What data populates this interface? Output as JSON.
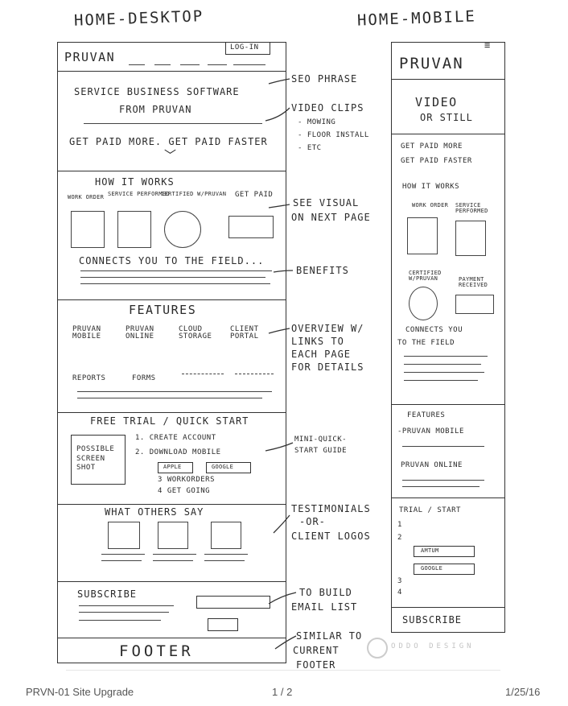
{
  "titles": {
    "desktop": "HOME-DESKTOP",
    "mobile": "HOME-MOBILE"
  },
  "desktop": {
    "logo": "PRUVAN",
    "login": "LOG-IN",
    "hero": {
      "line1": "SERVICE BUSINESS SOFTWARE",
      "line2": "FROM PRUVAN",
      "tagline": "GET PAID MORE. GET PAID FASTER"
    },
    "how": {
      "title": "HOW IT WORKS",
      "steps": [
        "WORK ORDER",
        "SERVICE PERFORMED",
        "CERTIFIED W/PRUVAN",
        "GET PAID"
      ],
      "connects": "CONNECTS YOU TO THE FIELD..."
    },
    "features": {
      "title": "FEATURES",
      "row1": [
        "PRUVAN MOBILE",
        "PRUVAN ONLINE",
        "CLOUD STORAGE",
        "CLIENT PORTAL"
      ],
      "row2": [
        "REPORTS",
        "FORMS"
      ]
    },
    "trial": {
      "title": "FREE TRIAL / QUICK START",
      "screenshot": "POSSIBLE SCREEN SHOT",
      "steps": [
        "1. CREATE ACCOUNT",
        "2. DOWNLOAD MOBILE",
        "3 WORKORDERS",
        "4 GET GOING"
      ],
      "apple": "APPLE",
      "google": "GOOGLE"
    },
    "testimonials": {
      "title": "WHAT OTHERS SAY"
    },
    "subscribe": {
      "title": "SUBSCRIBE"
    },
    "footer": "FOOTER"
  },
  "annotations": {
    "seo": "SEO PHRASE",
    "video": [
      "VIDEO CLIPS",
      "- MOWING",
      "- FLOOR INSTALL",
      "- ETC"
    ],
    "visual": [
      "SEE VISUAL",
      "ON NEXT PAGE"
    ],
    "benefits": "BENEFITS",
    "overview": [
      "OVERVIEW W/",
      "LINKS TO",
      "EACH PAGE",
      "FOR DETAILS"
    ],
    "mini": [
      "MINI-QUICK-",
      "START GUIDE"
    ],
    "testimonials": [
      "TESTIMONIALS",
      "-OR-",
      "CLIENT LOGOS"
    ],
    "email": [
      "TO BUILD",
      "EMAIL LIST"
    ],
    "similar": [
      "SIMILAR TO",
      "CURRENT",
      "FOOTER"
    ]
  },
  "mobile": {
    "logo": "PRUVAN",
    "video": [
      "VIDEO",
      "OR STILL"
    ],
    "tagline": [
      "GET PAID MORE",
      "GET PAID FASTER"
    ],
    "how": "HOW IT WORKS",
    "steps": [
      "WORK ORDER",
      "SERVICE PERFORMED",
      "CERTIFIED W/PRUVAN",
      "PAYMENT RECEIVED"
    ],
    "connects": [
      "CONNECTS YOU",
      "TO THE FIELD"
    ],
    "features": {
      "title": "FEATURES",
      "items": [
        "-PRUVAN MOBILE",
        "PRUVAN ONLINE"
      ]
    },
    "trial": {
      "title": "TRIAL / START",
      "steps": [
        "1",
        "2",
        "3",
        "4"
      ],
      "apple": "AMTUM",
      "google": "GOOGLE"
    },
    "subscribe": "SUBSCRIBE"
  },
  "watermark": "ODDO DESIGN",
  "page_footer": {
    "left": "PRVN-01 Site Upgrade",
    "center": "1 / 2",
    "right": "1/25/16"
  }
}
